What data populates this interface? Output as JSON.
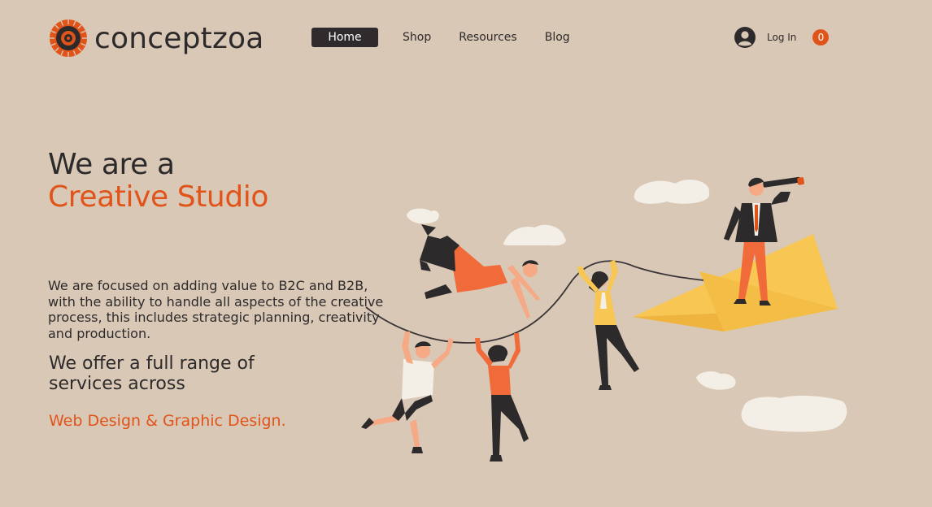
{
  "header": {
    "brand": "conceptzoa",
    "brand_icon": "sun-eye-logo-icon",
    "nav": [
      {
        "label": "Home",
        "active": true
      },
      {
        "label": "Shop",
        "active": false
      },
      {
        "label": "Resources",
        "active": false
      },
      {
        "label": "Blog",
        "active": false
      }
    ],
    "login_label": "Log In",
    "cart_count": "0"
  },
  "hero": {
    "line1": "We are a",
    "line2": "Creative Studio"
  },
  "description": "We are focused on adding value to B2C and B2B, with the ability to handle all aspects of the creative process, this includes strategic planning, creativity and production.",
  "offer": "We offer a full range of services across",
  "services": "Web Design & Graphic Design.",
  "colors": {
    "background": "#d9c8b6",
    "accent": "#e0541a",
    "text": "#2d2a2b"
  }
}
